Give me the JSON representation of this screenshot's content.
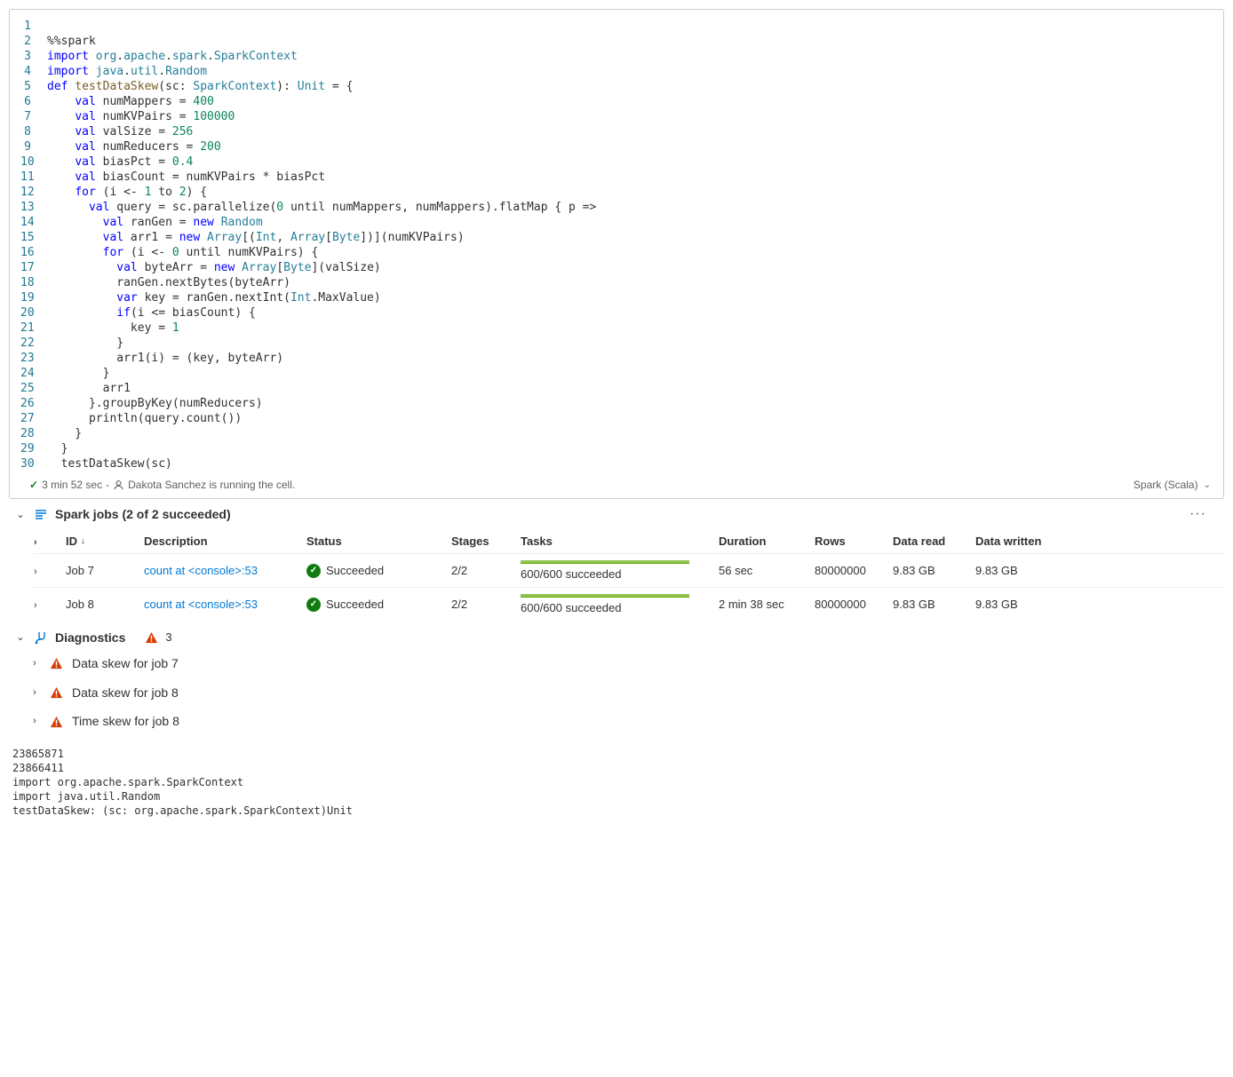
{
  "code": {
    "lines": [
      {
        "n": "1",
        "html": ""
      },
      {
        "n": "2",
        "html": "%%spark"
      },
      {
        "n": "3",
        "html": "<span class='kw'>import</span> <span class='pkg'>org</span>.<span class='pkg'>apache</span>.<span class='pkg'>spark</span>.<span class='pkg'>SparkContext</span>"
      },
      {
        "n": "4",
        "html": "<span class='kw'>import</span> <span class='pkg'>java</span>.<span class='pkg'>util</span>.<span class='pkg'>Random</span>"
      },
      {
        "n": "5",
        "html": "<span class='kw'>def</span> <span class='def'>testDataSkew</span>(sc: <span class='typ'>SparkContext</span>): <span class='typ'>Unit</span> = {"
      },
      {
        "n": "6",
        "html": "    <span class='kw'>val</span> numMappers = <span class='num'>400</span>"
      },
      {
        "n": "7",
        "html": "    <span class='kw'>val</span> numKVPairs = <span class='num'>100000</span>"
      },
      {
        "n": "8",
        "html": "    <span class='kw'>val</span> valSize = <span class='num'>256</span>"
      },
      {
        "n": "9",
        "html": "    <span class='kw'>val</span> numReducers = <span class='num'>200</span>"
      },
      {
        "n": "10",
        "html": "    <span class='kw'>val</span> biasPct = <span class='num'>0.4</span>"
      },
      {
        "n": "11",
        "html": "    <span class='kw'>val</span> biasCount = numKVPairs * biasPct"
      },
      {
        "n": "12",
        "html": "    <span class='kw'>for</span> (i &lt;- <span class='num'>1</span> to <span class='num'>2</span>) {"
      },
      {
        "n": "13",
        "html": "      <span class='kw'>val</span> query = sc.parallelize(<span class='num'>0</span> until numMappers, numMappers).flatMap { p =&gt;"
      },
      {
        "n": "14",
        "html": "        <span class='kw'>val</span> ranGen = <span class='kw'>new</span> <span class='typ'>Random</span>"
      },
      {
        "n": "15",
        "html": "        <span class='kw'>val</span> arr1 = <span class='kw'>new</span> <span class='typ'>Array</span>[(<span class='typ'>Int</span>, <span class='typ'>Array</span>[<span class='typ'>Byte</span>])](numKVPairs)"
      },
      {
        "n": "16",
        "html": "        <span class='kw'>for</span> (i &lt;- <span class='num'>0</span> until numKVPairs) {"
      },
      {
        "n": "17",
        "html": "          <span class='kw'>val</span> byteArr = <span class='kw'>new</span> <span class='typ'>Array</span>[<span class='typ'>Byte</span>](valSize)"
      },
      {
        "n": "18",
        "html": "          ranGen.nextBytes(byteArr)"
      },
      {
        "n": "19",
        "html": "          <span class='kw'>var</span> key = ranGen.nextInt(<span class='typ'>Int</span>.MaxValue)"
      },
      {
        "n": "20",
        "html": "          <span class='kw'>if</span>(i &lt;= biasCount) {"
      },
      {
        "n": "21",
        "html": "            key = <span class='num'>1</span>"
      },
      {
        "n": "22",
        "html": "          }"
      },
      {
        "n": "23",
        "html": "          arr1(i) = (key, byteArr)"
      },
      {
        "n": "24",
        "html": "        }"
      },
      {
        "n": "25",
        "html": "        arr1"
      },
      {
        "n": "26",
        "html": "      }.groupByKey(numReducers)"
      },
      {
        "n": "27",
        "html": "      println(query.count())"
      },
      {
        "n": "28",
        "html": "    }"
      },
      {
        "n": "29",
        "html": "  }"
      },
      {
        "n": "30",
        "html": "  testDataSkew(sc)"
      }
    ]
  },
  "status": {
    "duration": "3 min 52 sec",
    "runner_text": "Dakota Sanchez is running the cell.",
    "kernel": "Spark (Scala)"
  },
  "jobs": {
    "header": "Spark jobs (2 of 2 succeeded)",
    "columns": {
      "id": "ID",
      "desc": "Description",
      "status": "Status",
      "stages": "Stages",
      "tasks": "Tasks",
      "duration": "Duration",
      "rows": "Rows",
      "read": "Data read",
      "written": "Data written"
    },
    "rows": [
      {
        "id": "Job 7",
        "desc": "count at <console>:53",
        "status": "Succeeded",
        "stages": "2/2",
        "tasks": "600/600 succeeded",
        "duration": "56 sec",
        "rows": "80000000",
        "read": "9.83 GB",
        "written": "9.83 GB"
      },
      {
        "id": "Job 8",
        "desc": "count at <console>:53",
        "status": "Succeeded",
        "stages": "2/2",
        "tasks": "600/600 succeeded",
        "duration": "2 min 38 sec",
        "rows": "80000000",
        "read": "9.83 GB",
        "written": "9.83 GB"
      }
    ]
  },
  "diagnostics": {
    "title": "Diagnostics",
    "count": "3",
    "items": [
      "Data skew for job 7",
      "Data skew for job 8",
      "Time skew for job 8"
    ]
  },
  "output_lines": [
    "23865871",
    "23866411",
    "import org.apache.spark.SparkContext",
    "import java.util.Random",
    "testDataSkew: (sc: org.apache.spark.SparkContext)Unit"
  ]
}
